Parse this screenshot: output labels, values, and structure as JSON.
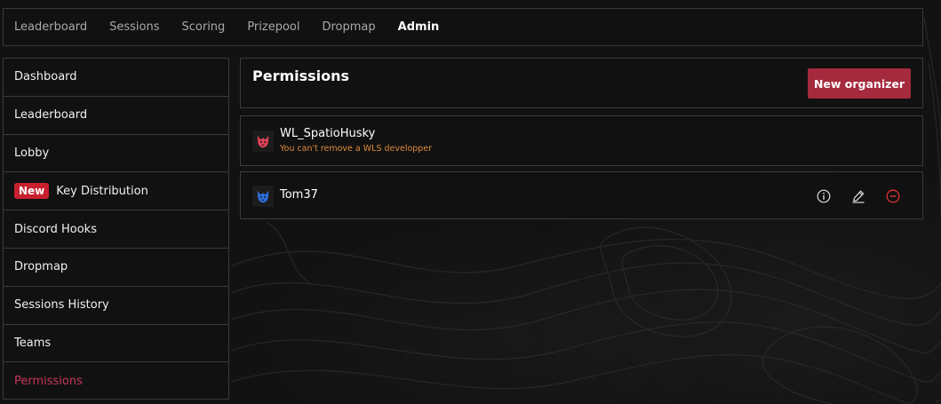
{
  "topnav": {
    "items": [
      {
        "label": "Leaderboard",
        "active": false
      },
      {
        "label": "Sessions",
        "active": false
      },
      {
        "label": "Scoring",
        "active": false
      },
      {
        "label": "Prizepool",
        "active": false
      },
      {
        "label": "Dropmap",
        "active": false
      },
      {
        "label": "Admin",
        "active": true
      }
    ]
  },
  "sidebar": {
    "items": [
      {
        "label": "Dashboard"
      },
      {
        "label": "Leaderboard"
      },
      {
        "label": "Lobby"
      },
      {
        "label": "Key Distribution",
        "badge": "New"
      },
      {
        "label": "Discord Hooks"
      },
      {
        "label": "Dropmap"
      },
      {
        "label": "Sessions History"
      },
      {
        "label": "Teams"
      },
      {
        "label": "Permissions",
        "active": true
      }
    ]
  },
  "main": {
    "title": "Permissions",
    "new_button_label": "New organizer",
    "organizers": [
      {
        "name": "WL_SpatioHusky",
        "note": "You can't remove a WLS developper",
        "avatar_color": "#e0435a",
        "avatar_icon": "husky-mascot-icon"
      },
      {
        "name": "Tom37",
        "avatar_color": "#2b6fe0",
        "avatar_icon": "husky-mascot-icon",
        "actions": [
          "info-icon",
          "edit-icon",
          "remove-icon"
        ]
      }
    ]
  },
  "colors": {
    "accent": "#a52a3d",
    "active_link": "#c8365a",
    "badge": "#c8202f",
    "warning": "#e08a3a",
    "remove": "#e0302f"
  }
}
